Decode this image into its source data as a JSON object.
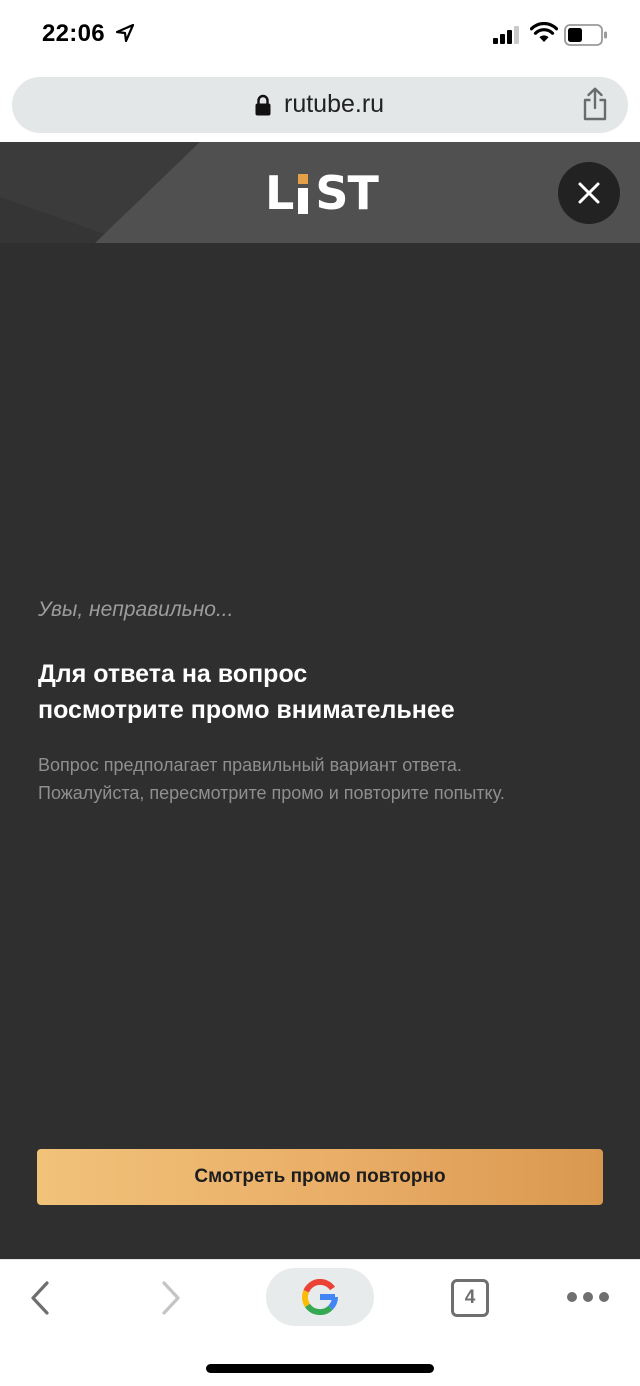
{
  "status_bar": {
    "time": "22:06"
  },
  "browser": {
    "url": "rutube.ru"
  },
  "header": {
    "logo_letters": [
      "L",
      "S",
      "T"
    ],
    "logo_text": "LiST",
    "accent_color": "#e3a048"
  },
  "result": {
    "sorry": "Увы, неправильно...",
    "headline_lines": [
      "Для ответа на вопрос",
      "посмотрите промо внимательнее"
    ],
    "body_lines": [
      "Вопрос предполагает правильный вариант ответа.",
      "Пожалуйста, пересмотрите промо и повторите попытку."
    ],
    "cta_label": "Смотреть промо повторно"
  },
  "toolbar": {
    "tab_count": "4"
  }
}
